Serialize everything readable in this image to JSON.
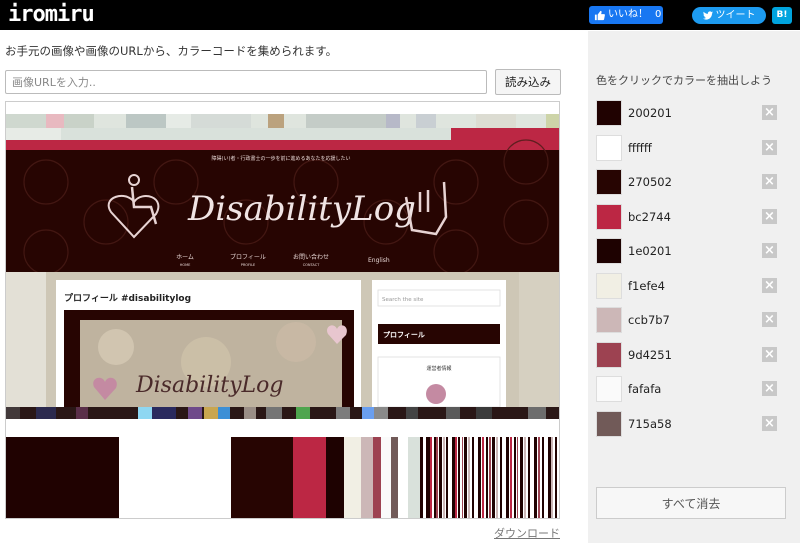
{
  "header": {
    "logo": "iromiru",
    "like_label": "いいね！",
    "like_count": "0",
    "tweet_label": "ツイート",
    "hatena_label": "B!"
  },
  "main": {
    "intro": "お手元の画像や画像のURLから、カラーコードを集められます。",
    "url_placeholder": "画像URLを入力..",
    "load_button": "読み込み",
    "download_link": "ダウンロード"
  },
  "preview": {
    "site_tagline": "障碍(い)者・行政書士の一歩を前に進めるあなたを応援したい",
    "site_title": "DisabilityLog",
    "nav": [
      {
        "label": "ホーム",
        "sub": "HOME"
      },
      {
        "label": "プロフィール",
        "sub": "PROFILE"
      },
      {
        "label": "お問い合わせ",
        "sub": "CONTACT"
      },
      {
        "label": "English",
        "sub": ""
      }
    ],
    "post_title": "プロフィール #disabilitylog",
    "search_placeholder": "Search the site",
    "widget_title": "プロフィール",
    "author_label": "運営者情報"
  },
  "sidebar": {
    "instruction": "色をクリックでカラーを抽出しよう",
    "clear_button": "すべて消去",
    "colors": [
      {
        "hex": "200201",
        "color": "#200201"
      },
      {
        "hex": "ffffff",
        "color": "#ffffff"
      },
      {
        "hex": "270502",
        "color": "#270502"
      },
      {
        "hex": "bc2744",
        "color": "#bc2744"
      },
      {
        "hex": "1e0201",
        "color": "#1e0201"
      },
      {
        "hex": "f1efe4",
        "color": "#f1efe4"
      },
      {
        "hex": "ccb7b7",
        "color": "#ccb7b7"
      },
      {
        "hex": "9d4251",
        "color": "#9d4251"
      },
      {
        "hex": "fafafa",
        "color": "#fafafa"
      },
      {
        "hex": "715a58",
        "color": "#715a58"
      }
    ]
  },
  "colors": {
    "topbar": "#000000",
    "sidebar_bg": "#f0f0f0",
    "accent_red": "#bc2744",
    "dark_brown": "#200201"
  }
}
